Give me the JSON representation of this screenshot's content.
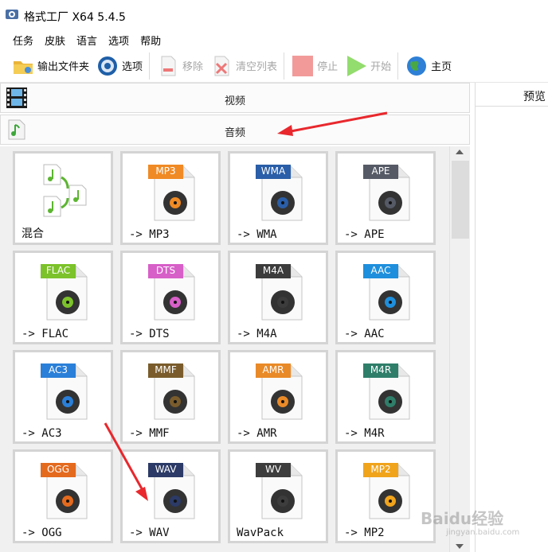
{
  "window": {
    "title": "格式工厂 X64 5.4.5"
  },
  "menu": [
    "任务",
    "皮肤",
    "语言",
    "选项",
    "帮助"
  ],
  "toolbar": {
    "output_folder": "输出文件夹",
    "options": "选项",
    "remove": "移除",
    "clear_list": "清空列表",
    "stop": "停止",
    "start": "开始",
    "home": "主页"
  },
  "categories": {
    "video": "视频",
    "audio": "音频"
  },
  "preview": {
    "header": "预览"
  },
  "tiles": [
    {
      "badge": "",
      "label": "混合",
      "color": "#6ab344",
      "icon": "mix-notes-icon"
    },
    {
      "badge": "MP3",
      "label": "-> MP3",
      "color": "#f08a24",
      "icon": "vinyl-icon"
    },
    {
      "badge": "WMA",
      "label": "-> WMA",
      "color": "#2a5ea8",
      "icon": "play-disc-icon"
    },
    {
      "badge": "APE",
      "label": "-> APE",
      "color": "#555a66",
      "icon": "headphones-icon"
    },
    {
      "badge": "FLAC",
      "label": "-> FLAC",
      "color": "#7cc22a",
      "icon": "headphones-green-icon"
    },
    {
      "badge": "DTS",
      "label": "-> DTS",
      "color": "#d75fc8",
      "icon": "speaker-icon"
    },
    {
      "badge": "M4A",
      "label": "-> M4A",
      "color": "#3c3c3c",
      "icon": "cd-music-icon"
    },
    {
      "badge": "AAC",
      "label": "-> AAC",
      "color": "#1e8fdc",
      "icon": "speaker-blue-icon"
    },
    {
      "badge": "AC3",
      "label": "-> AC3",
      "color": "#2a7fd8",
      "icon": "speaker-green-icon"
    },
    {
      "badge": "MMF",
      "label": "-> MMF",
      "color": "#7a5c2c",
      "icon": "envelope-icon"
    },
    {
      "badge": "AMR",
      "label": "-> AMR",
      "color": "#e98a28",
      "icon": "mixer-icon"
    },
    {
      "badge": "M4R",
      "label": "-> M4R",
      "color": "#2f7e6a",
      "icon": "phone-icon"
    },
    {
      "badge": "OGG",
      "label": "-> OGG",
      "color": "#e46a1e",
      "icon": "note-icon"
    },
    {
      "badge": "WAV",
      "label": "-> WAV",
      "color": "#2b3a66",
      "icon": "notes-icon"
    },
    {
      "badge": "WV",
      "label": "WavPack",
      "color": "#3d3d3d",
      "icon": "green-notes-icon"
    },
    {
      "badge": "MP2",
      "label": "-> MP2",
      "color": "#f0a41c",
      "icon": "vinyl-orange-icon"
    }
  ],
  "watermark": {
    "brand": "Baidu经验",
    "sub": "jingyan.baidu.com"
  },
  "colors": {
    "accent_red": "#e8282d",
    "stop_red": "#f08c8c",
    "start_green": "#8fd86a"
  }
}
